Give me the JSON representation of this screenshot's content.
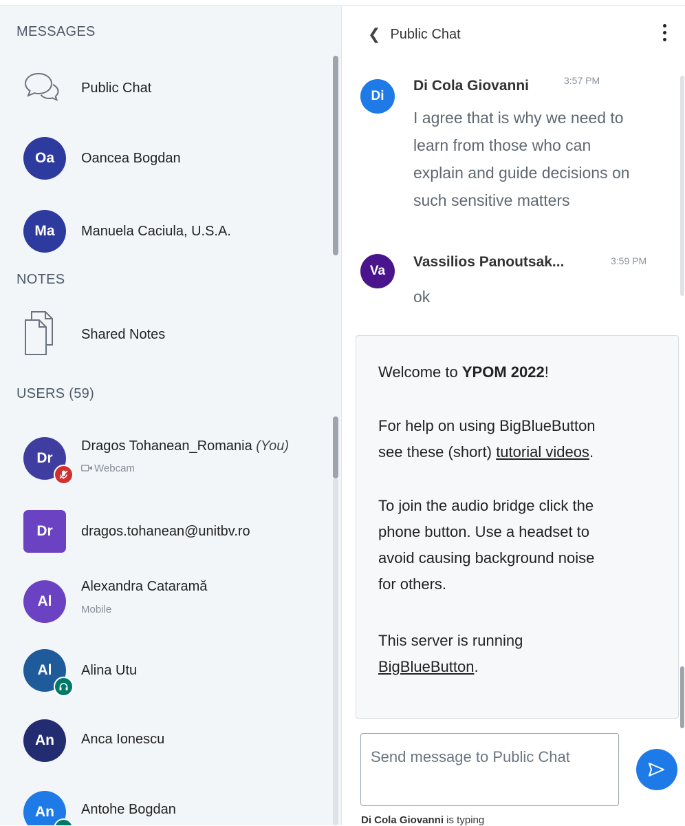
{
  "left_panel": {
    "messages_title": "MESSAGES",
    "messages": [
      {
        "label": "Public Chat"
      },
      {
        "label": "Oancea Bogdan",
        "initials": "Oa"
      },
      {
        "label": "Manuela Caciula, U.S.A.",
        "initials": "Ma"
      }
    ],
    "notes_title": "NOTES",
    "notes": [
      {
        "label": "Shared Notes"
      }
    ],
    "users_title": "USERS (59)",
    "users": [
      {
        "initials": "Dr",
        "name": "Dragos Tohanean_Romania",
        "you_tag": "(You)",
        "status": "Webcam",
        "color": "#3f3ea0"
      },
      {
        "initials": "Dr",
        "name": "dragos.tohanean@unitbv.ro",
        "color": "#6b42c2"
      },
      {
        "initials": "Al",
        "name": "Alexandra Catarамă",
        "status": "Mobile",
        "color": "#6b42c2"
      },
      {
        "initials": "Al",
        "name": "Alina Utu",
        "color": "#1f5a9a"
      },
      {
        "initials": "An",
        "name": "Anca Ionescu",
        "color": "#232c70"
      },
      {
        "initials": "An",
        "name": "Antohe Bogdan",
        "color": "#1e7ae6"
      }
    ]
  },
  "chat": {
    "header_title": "Public Chat",
    "messages": [
      {
        "initials": "Di",
        "sender": "Di Cola Giovanni",
        "time": "3:57 PM",
        "lines": [
          "I agree that is why we need to",
          "learn from those who can",
          "explain and guide decisions on",
          "such sensitive matters"
        ]
      },
      {
        "initials": "Va",
        "sender": "Vassilios Panoutsak...",
        "time": "3:59 PM",
        "lines": [
          "ok"
        ]
      }
    ],
    "welcome": {
      "p1_pre": "Welcome to ",
      "p1_bold": "YPOM 2022",
      "p1_post": "!",
      "p2_line1": "For help on using BigBlueButton",
      "p2_pre": "see these (short) ",
      "p2_link": "tutorial videos",
      "p2_post": ".",
      "p3_lines": [
        "To join the audio bridge click the",
        "phone button. Use a headset to",
        "avoid causing background noise",
        "for others."
      ],
      "p4_line1": "This server is running",
      "p4_link": "BigBlueButton",
      "p4_post": "."
    },
    "input_placeholder": "Send message to Public Chat",
    "typing_name": "Di Cola Giovanni",
    "typing_suffix": " is typing"
  },
  "colors": {
    "primary": "#1e7ae6",
    "panel_bg": "#f3f6f9",
    "oancea": "#2d3a9e",
    "manuela": "#2d3a9e",
    "di_cola": "#1e7ae6",
    "vassilios": "#4a148c",
    "muted_badge": "#d32f2f",
    "headset_badge": "#00796b"
  },
  "icons": [
    "chat-bubbles-icon",
    "notes-pages-icon",
    "webcam-icon",
    "muted-mic-icon",
    "headset-icon",
    "send-icon",
    "chevron-left-icon",
    "more-vertical-icon"
  ]
}
